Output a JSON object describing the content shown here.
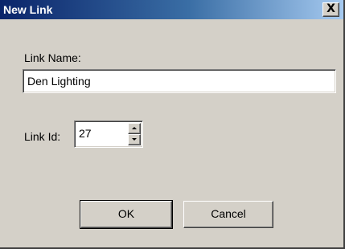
{
  "window": {
    "title": "New Link",
    "close_glyph": "X"
  },
  "form": {
    "name_label": "Link Name:",
    "name_value": "Den Lighting",
    "id_label": "Link Id:",
    "id_value": "27"
  },
  "buttons": {
    "ok_label": "OK",
    "cancel_label": "Cancel"
  },
  "icons": {
    "close": "close-icon",
    "spin_up": "arrow-up-icon",
    "spin_down": "arrow-down-icon"
  },
  "colors": {
    "title_gradient_start": "#0a246a",
    "title_gradient_end": "#a6caf0",
    "dialog_face": "#d4d0c8"
  }
}
